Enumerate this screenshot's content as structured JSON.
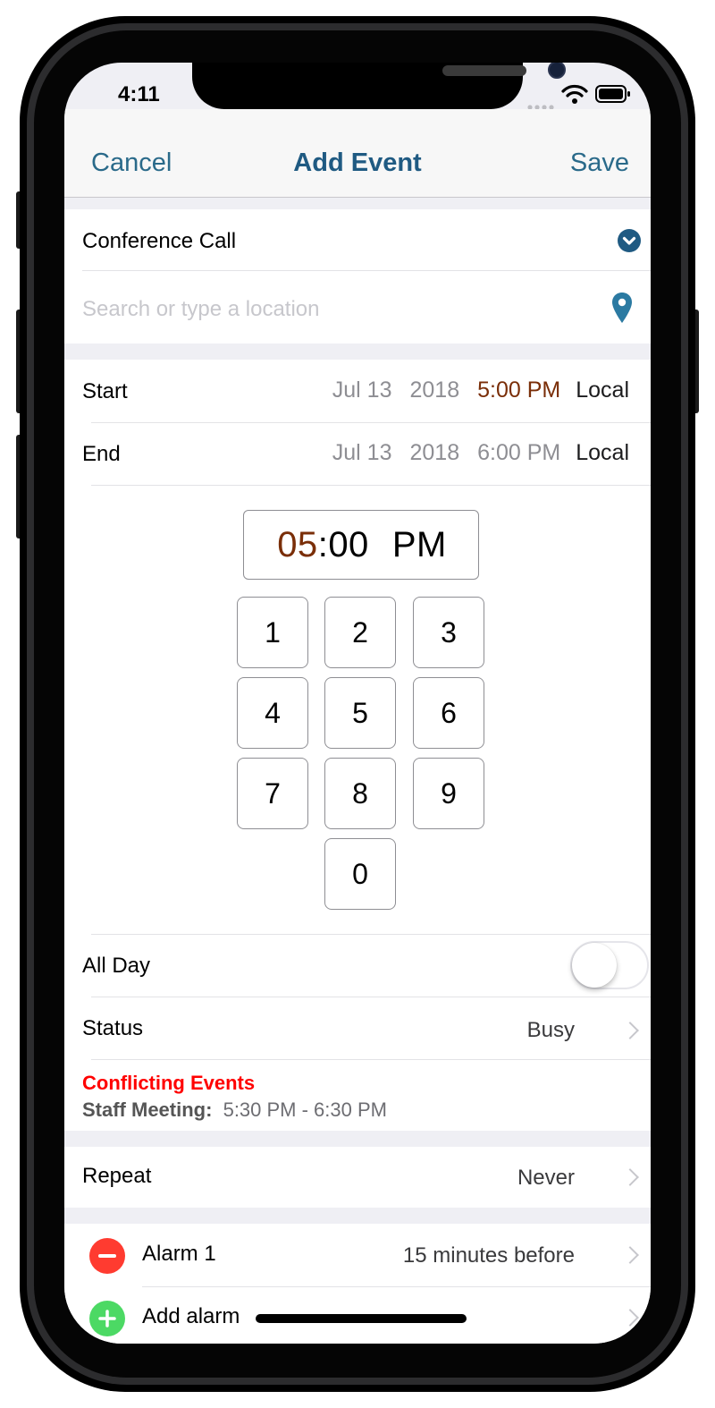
{
  "status_bar": {
    "time": "4:11"
  },
  "nav": {
    "cancel": "Cancel",
    "title": "Add Event",
    "save": "Save"
  },
  "event": {
    "title": "Conference Call",
    "location_placeholder": "Search or type a location"
  },
  "start": {
    "label": "Start",
    "date": "Jul 13",
    "year": "2018",
    "time": "5:00 PM",
    "tz": "Local"
  },
  "end": {
    "label": "End",
    "date": "Jul 13",
    "year": "2018",
    "time": "6:00 PM",
    "tz": "Local"
  },
  "picker": {
    "hour": "05",
    "colon": ":",
    "minute": "00",
    "ampm": "PM",
    "keys": [
      "1",
      "2",
      "3",
      "4",
      "5",
      "6",
      "7",
      "8",
      "9",
      "0"
    ]
  },
  "all_day": {
    "label": "All Day",
    "on": false
  },
  "status": {
    "label": "Status",
    "value": "Busy"
  },
  "conflicts": {
    "heading": "Conflicting Events",
    "name": "Staff Meeting:",
    "time": "5:30 PM - 6:30 PM"
  },
  "repeat": {
    "label": "Repeat",
    "value": "Never"
  },
  "alarms": {
    "alarm1_label": "Alarm 1",
    "alarm1_value": "15 minutes before",
    "add_label": "Add alarm"
  },
  "colors": {
    "accent": "#1f5a82",
    "link": "#2a6a8a",
    "start_time": "#7a2e08",
    "conflict": "#ff0000",
    "remove": "#ff3b30",
    "add": "#4cd964"
  },
  "icons": {
    "title_dropdown": "chevron-down-circle-icon",
    "location": "map-pin-icon",
    "remove": "minus-circle-icon",
    "add": "plus-circle-icon"
  }
}
